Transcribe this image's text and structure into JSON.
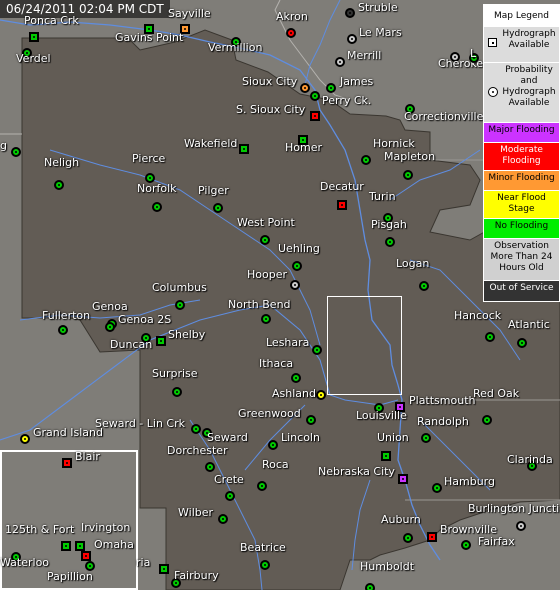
{
  "timestamp": "06/24/2011 02:04 PM CDT",
  "colors": {
    "no_flooding": "#00cc00",
    "minor": "#ff9933",
    "moderate": "#ff0000",
    "major": "#cc33ff",
    "near": "#ffff00",
    "observation_old": "#cccccc",
    "out_of_service": "#333333",
    "map_region": "#6a625a",
    "map_outside": "#807e79"
  },
  "legend": {
    "title": "Map Legend",
    "hydrograph": "Hydrograph Available",
    "probability": "Probability and Hydrograph Available",
    "major": "Major Flooding",
    "moderate": "Moderate Flooding",
    "minor": "Minor Flooding",
    "near": "Near Flood Stage",
    "none": "No Flooding",
    "old": "Observation More Than 24 Hours Old",
    "oos": "Out of Service"
  },
  "sites": [
    {
      "name": "Ponca Crk",
      "status": "none",
      "shape": "square"
    },
    {
      "name": "Sayville",
      "status": "minor",
      "shape": "square"
    },
    {
      "name": "Akron",
      "status": "moderate",
      "shape": "circle"
    },
    {
      "name": "Struble",
      "status": "oos",
      "shape": "circle"
    },
    {
      "name": "Gavins Point",
      "status": "none",
      "shape": "square"
    },
    {
      "name": "Vermillion",
      "status": "none",
      "shape": "circle"
    },
    {
      "name": "Le Mars",
      "status": "old",
      "shape": "circle"
    },
    {
      "name": "Verdel",
      "status": "none",
      "shape": "circle"
    },
    {
      "name": "Merrill",
      "status": "old",
      "shape": "circle"
    },
    {
      "name": "Cherokee",
      "status": "old",
      "shape": "circle"
    },
    {
      "name": "Sioux City",
      "status": "minor",
      "shape": "circle"
    },
    {
      "name": "James",
      "status": "none",
      "shape": "circle"
    },
    {
      "name": "Perry Ck.",
      "status": "none",
      "shape": "circle"
    },
    {
      "name": "S. Sioux City",
      "status": "moderate",
      "shape": "square"
    },
    {
      "name": "Correctionville",
      "status": "none",
      "shape": "circle"
    },
    {
      "name": "Wakefield",
      "status": "none",
      "shape": "square"
    },
    {
      "name": "Homer",
      "status": "none",
      "shape": "square"
    },
    {
      "name": "Hornick",
      "status": "none",
      "shape": "circle"
    },
    {
      "name": "Mapleton",
      "status": "none",
      "shape": "circle"
    },
    {
      "name": "Neligh",
      "status": "none",
      "shape": "circle"
    },
    {
      "name": "Pierce",
      "status": "none",
      "shape": "circle"
    },
    {
      "name": "Norfolk",
      "status": "none",
      "shape": "circle"
    },
    {
      "name": "Pilger",
      "status": "none",
      "shape": "circle"
    },
    {
      "name": "Decatur",
      "status": "moderate",
      "shape": "square"
    },
    {
      "name": "Turin",
      "status": "none",
      "shape": "circle"
    },
    {
      "name": "West Point",
      "status": "none",
      "shape": "circle"
    },
    {
      "name": "Pisgah",
      "status": "none",
      "shape": "circle"
    },
    {
      "name": "Uehling",
      "status": "none",
      "shape": "circle"
    },
    {
      "name": "Hooper",
      "status": "old",
      "shape": "circle"
    },
    {
      "name": "Logan",
      "status": "none",
      "shape": "circle"
    },
    {
      "name": "Columbus",
      "status": "none",
      "shape": "circle"
    },
    {
      "name": "North Bend",
      "status": "none",
      "shape": "circle"
    },
    {
      "name": "Fullerton",
      "status": "none",
      "shape": "circle"
    },
    {
      "name": "Genoa",
      "status": "none",
      "shape": "circle"
    },
    {
      "name": "Genoa 2S",
      "status": "none",
      "shape": "circle"
    },
    {
      "name": "Duncan",
      "status": "none",
      "shape": "circle"
    },
    {
      "name": "Shelby",
      "status": "none",
      "shape": "square"
    },
    {
      "name": "Hancock",
      "status": "none",
      "shape": "circle"
    },
    {
      "name": "Atlantic",
      "status": "none",
      "shape": "circle"
    },
    {
      "name": "Leshara",
      "status": "none",
      "shape": "circle"
    },
    {
      "name": "Ithaca",
      "status": "none",
      "shape": "circle"
    },
    {
      "name": "Surprise",
      "status": "none",
      "shape": "circle"
    },
    {
      "name": "Ashland",
      "status": "near",
      "shape": "circle"
    },
    {
      "name": "Plattsmouth",
      "status": "major",
      "shape": "square"
    },
    {
      "name": "Red Oak",
      "status": "none",
      "shape": "circle"
    },
    {
      "name": "Seward - Lin Crk",
      "status": "none",
      "shape": "circle"
    },
    {
      "name": "Greenwood",
      "status": "none",
      "shape": "circle"
    },
    {
      "name": "Louisville",
      "status": "none",
      "shape": "circle"
    },
    {
      "name": "Randolph",
      "status": "none",
      "shape": "circle"
    },
    {
      "name": "Grand Island",
      "status": "near",
      "shape": "circle"
    },
    {
      "name": "Seward",
      "status": "none",
      "shape": "circle"
    },
    {
      "name": "Lincoln",
      "status": "none",
      "shape": "circle"
    },
    {
      "name": "Union",
      "status": "none",
      "shape": "square"
    },
    {
      "name": "Dorchester",
      "status": "none",
      "shape": "circle"
    },
    {
      "name": "Clarinda",
      "status": "none",
      "shape": "circle"
    },
    {
      "name": "Blair",
      "status": "moderate",
      "shape": "square"
    },
    {
      "name": "Roca",
      "status": "none",
      "shape": "circle"
    },
    {
      "name": "Nebraska City",
      "status": "major",
      "shape": "square"
    },
    {
      "name": "Crete",
      "status": "none",
      "shape": "circle"
    },
    {
      "name": "Hamburg",
      "status": "none",
      "shape": "circle"
    },
    {
      "name": "Burlington Junction",
      "status": "old",
      "shape": "circle"
    },
    {
      "name": "Wilber",
      "status": "none",
      "shape": "circle"
    },
    {
      "name": "125th & Fort",
      "status": "none",
      "shape": "square"
    },
    {
      "name": "Irvington",
      "status": "none",
      "shape": "square"
    },
    {
      "name": "Auburn",
      "status": "none",
      "shape": "circle"
    },
    {
      "name": "Brownville",
      "status": "moderate",
      "shape": "square"
    },
    {
      "name": "Omaha",
      "status": "moderate",
      "shape": "square"
    },
    {
      "name": "Fairfax",
      "status": "none",
      "shape": "circle"
    },
    {
      "name": "Waterloo",
      "status": "none",
      "shape": "circle"
    },
    {
      "name": "Beatrice",
      "status": "none",
      "shape": "circle"
    },
    {
      "name": "Papillion",
      "status": "none",
      "shape": "circle"
    },
    {
      "name": "Fairbury",
      "status": "none",
      "shape": "circle"
    },
    {
      "name": "Humboldt",
      "status": "none",
      "shape": "circle"
    },
    {
      "name": "g",
      "status": "none",
      "shape": "circle"
    },
    {
      "name": "L",
      "status": "none",
      "shape": "circle"
    },
    {
      "name": "ria",
      "status": "none",
      "shape": "square"
    }
  ]
}
